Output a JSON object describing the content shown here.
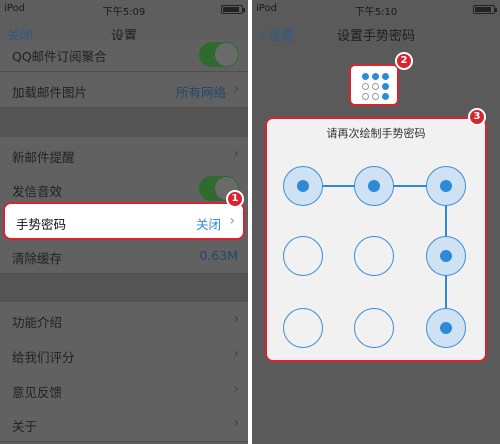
{
  "left_screen": {
    "status": {
      "carrier": "iPod",
      "time": "下午5:09"
    },
    "nav": {
      "title": "设置",
      "back": "关闭"
    },
    "rows": {
      "qq_subscription": "QQ邮件订阅聚合",
      "load_images": {
        "label": "加载邮件图片",
        "value": "所有网络"
      },
      "new_mail_alert": "新邮件提醒",
      "send_sound": "发信音效",
      "gesture_password": {
        "label": "手势密码",
        "value": "关闭"
      },
      "clear_cache": {
        "label": "清除缓存",
        "value": "0.63M"
      },
      "features": "功能介绍",
      "rate_us": "给我们评分",
      "feedback": "意见反馈",
      "about": "关于"
    },
    "toggles": {
      "qq_subscription": true,
      "send_sound": true
    }
  },
  "right_screen": {
    "status": {
      "carrier": "iPod",
      "time": "下午5:10"
    },
    "nav": {
      "title": "设置手势密码",
      "back": "设置"
    },
    "prompt": "请再次绘制手势密码",
    "pattern": {
      "selected_nodes": [
        1,
        2,
        3,
        6,
        9
      ],
      "path_order": [
        1,
        2,
        3,
        6,
        9
      ]
    }
  },
  "callouts": [
    "1",
    "2",
    "3"
  ],
  "colors": {
    "accent": "#2d8ad8",
    "highlight_border": "#d9232e",
    "toggle_on": "#4cd964"
  }
}
